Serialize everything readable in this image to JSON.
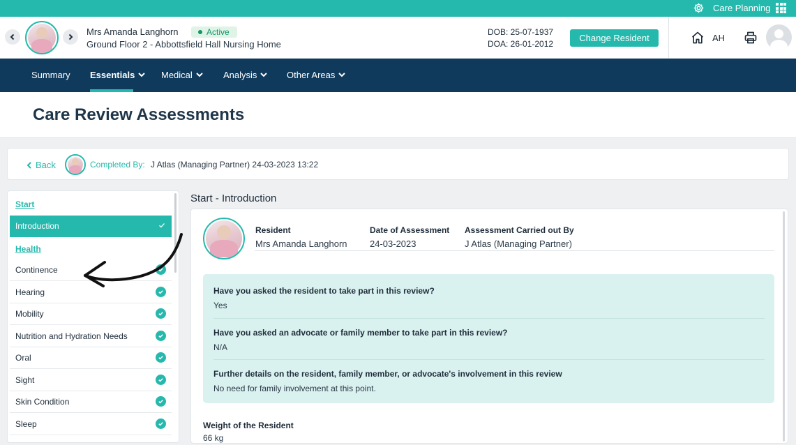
{
  "topbar": {
    "app_name": "Care Planning",
    "icons": [
      "gear-icon",
      "apps-grid-icon"
    ]
  },
  "resident": {
    "name": "Mrs Amanda Langhorn",
    "status": "Active",
    "location": "Ground Floor 2 - Abbottsfield Hall Nursing Home",
    "dob": "DOB: 25-07-1937",
    "doa": "DOA: 26-01-2012",
    "change_label": "Change Resident"
  },
  "user": {
    "initials": "AH"
  },
  "nav": {
    "items": [
      {
        "label": "Summary",
        "dropdown": false
      },
      {
        "label": "Essentials",
        "dropdown": true,
        "active": true
      },
      {
        "label": "Medical",
        "dropdown": true
      },
      {
        "label": "Analysis",
        "dropdown": true
      },
      {
        "label": "Other Areas",
        "dropdown": true
      }
    ]
  },
  "page": {
    "title": "Care Review Assessments"
  },
  "backbar": {
    "back_label": "Back",
    "completed_label": "Completed By:",
    "completed_value": "J Atlas (Managing Partner) 24-03-2023 13:22"
  },
  "sidebar": {
    "start_heading": "Start",
    "health_heading": "Health",
    "items": [
      {
        "label": "Introduction",
        "active": true
      },
      {
        "label": "Continence",
        "complete": true
      },
      {
        "label": "Hearing",
        "complete": true
      },
      {
        "label": "Mobility",
        "complete": true
      },
      {
        "label": "Nutrition and Hydration Needs",
        "complete": true
      },
      {
        "label": "Oral",
        "complete": true
      },
      {
        "label": "Sight",
        "complete": true
      },
      {
        "label": "Skin Condition",
        "complete": true
      },
      {
        "label": "Sleep",
        "complete": true
      }
    ]
  },
  "content": {
    "section_title": "Start - Introduction",
    "info": {
      "resident_label": "Resident",
      "resident_value": "Mrs Amanda Langhorn",
      "date_label": "Date of Assessment",
      "date_value": "24-03-2023",
      "by_label": "Assessment Carried out By",
      "by_value": "J Atlas (Managing Partner)"
    },
    "qa": [
      {
        "q": "Have you asked the resident to take part in this review?",
        "a": "Yes"
      },
      {
        "q": "Have you asked an advocate or family member to take part in this review?",
        "a": "N/A"
      },
      {
        "q": "Further details on the resident, family member, or advocate's involvement in this review",
        "a": "No need for family involvement at this point."
      }
    ],
    "weight": {
      "q": "Weight of the Resident",
      "a": "66 kg"
    }
  },
  "colors": {
    "accent": "#25b9ad",
    "nav_bg": "#0f3a5c",
    "qa_bg": "#d9f1ef"
  }
}
